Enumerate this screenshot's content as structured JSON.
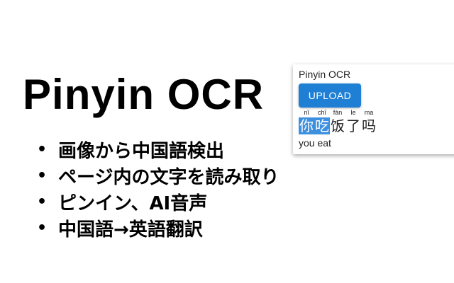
{
  "promo": {
    "title": "Pinyin OCR",
    "features": [
      "画像から中国語検出",
      "ページ内の文字を読み取り",
      "ピンイン、AI音声",
      "中国語→英語翻訳"
    ]
  },
  "popup": {
    "title": "Pinyin OCR",
    "upload_label": "UPLOAD",
    "characters": [
      {
        "hanzi": "你",
        "pinyin": "nǐ",
        "selected": true
      },
      {
        "hanzi": "吃",
        "pinyin": "chī",
        "selected": true
      },
      {
        "hanzi": "饭",
        "pinyin": "fàn",
        "selected": false
      },
      {
        "hanzi": "了",
        "pinyin": "le",
        "selected": false
      },
      {
        "hanzi": "吗",
        "pinyin": "ma",
        "selected": false
      }
    ],
    "translation": "you eat"
  },
  "colors": {
    "accent": "#1e7fd4",
    "selection": "#3d8fe0"
  }
}
